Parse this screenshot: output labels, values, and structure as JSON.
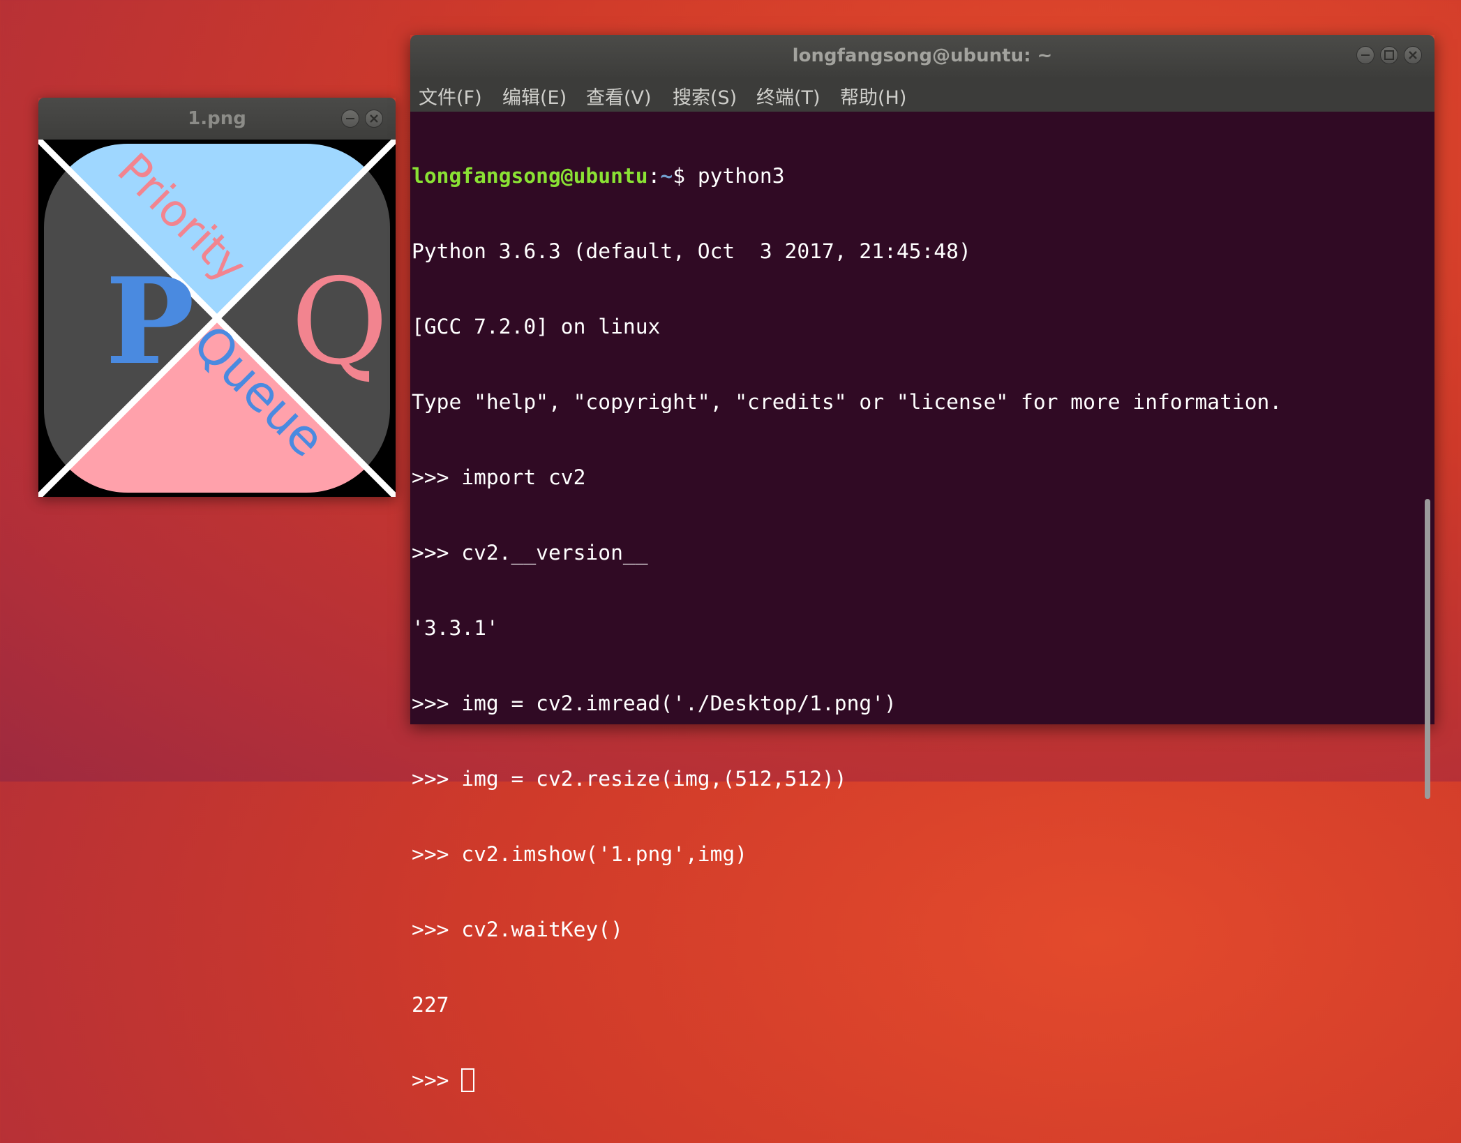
{
  "image_window": {
    "title": "1.png",
    "image": {
      "letter_left": "P",
      "letter_right": "Q",
      "word_top": "Priority",
      "word_bottom": "Queue",
      "colors": {
        "top": "#9fd7ff",
        "bottom": "#ffa1ab",
        "sides": "#4a4a4a",
        "blue_text": "#4a8ae0",
        "pink_text": "#f2848f",
        "border": "#000000",
        "cross": "#ffffff"
      }
    }
  },
  "terminal": {
    "title": "longfangsong@ubuntu: ~",
    "menu": [
      "文件(F)",
      "编辑(E)",
      "查看(V)",
      "搜索(S)",
      "终端(T)",
      "帮助(H)"
    ],
    "prompt": {
      "user_host": "longfangsong@ubuntu",
      "separator": ":",
      "path": "~",
      "symbol": "$ ",
      "command": "python3"
    },
    "lines": [
      "Python 3.6.3 (default, Oct  3 2017, 21:45:48) ",
      "[GCC 7.2.0] on linux",
      "Type \"help\", \"copyright\", \"credits\" or \"license\" for more information.",
      ">>> import cv2",
      ">>> cv2.__version__",
      "'3.3.1'",
      ">>> img = cv2.imread('./Desktop/1.png')",
      ">>> img = cv2.resize(img,(512,512))",
      ">>> cv2.imshow('1.png',img)",
      ">>> cv2.waitKey()",
      "227"
    ],
    "final_prompt": ">>> "
  }
}
